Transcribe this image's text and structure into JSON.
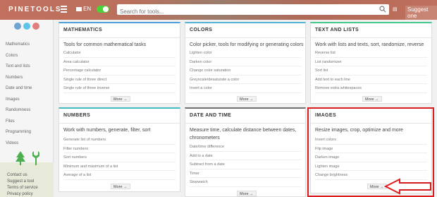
{
  "header": {
    "logo": "PINETOOLS",
    "lang": "EN",
    "search_placeholder": "Search for tools...",
    "small_icon": "▤",
    "suggest": "Suggest one"
  },
  "sidebar": {
    "items": [
      "Mathematics",
      "Colors",
      "Text and lists",
      "Numbers",
      "Date and time",
      "Images",
      "Randomness",
      "Files",
      "Programming",
      "Videos"
    ],
    "links": [
      "Contact us",
      "Suggest a tool",
      "Terms of service",
      "Privacy policy"
    ],
    "social_colors": [
      "#6fa3d0",
      "#5ec3e8",
      "#e07c7c"
    ]
  },
  "cards": {
    "math": {
      "title": "MATHEMATICS",
      "desc": "Tools for common mathematical tasks",
      "tools": [
        "Calculator",
        "Area calculator",
        "Percentage calculator",
        "Single rule of three direct",
        "Single rule of three inverse"
      ],
      "more": "More →"
    },
    "colors": {
      "title": "COLORS",
      "desc": "Color picker, tools for modifying or generating colors",
      "tools": [
        "Lighten color",
        "Darken color",
        "Change color saturation",
        "Greyscale/desaturate a color",
        "Invert a color"
      ],
      "more": "More →"
    },
    "text": {
      "title": "TEXT AND LISTS",
      "desc": "Work with lists and texts, sort, randomize, reverse",
      "tools": [
        "Reverse list",
        "List randomizer",
        "Sort list",
        "Add text to each line",
        "Remove extra whitespaces"
      ],
      "more": "More →"
    },
    "numbers": {
      "title": "NUMBERS",
      "desc": "Work with numbers, generate, filter, sort",
      "tools": [
        "Generate list of numbers",
        "Filter numbers",
        "Sort numbers",
        "Minimum and maximum of a list",
        "Average of a list"
      ],
      "more": "More →"
    },
    "date": {
      "title": "DATE AND TIME",
      "desc": "Measure time, calculate distance between dates, chronometers",
      "tools": [
        "Date/time difference",
        "Add to a date",
        "Subtract from a date",
        "Timer",
        "Stopwatch"
      ],
      "more": "More →"
    },
    "images": {
      "title": "IMAGES",
      "desc": "Resize images, crop, optimize and more",
      "tools": [
        "Invert colors",
        "Flip image",
        "Darken image",
        "Lighten image",
        "Change brightness"
      ],
      "more": "More →"
    }
  },
  "colors": {
    "highlight": "#d81e1e",
    "toggle": "#4cd137",
    "tree": "#4caf50"
  }
}
